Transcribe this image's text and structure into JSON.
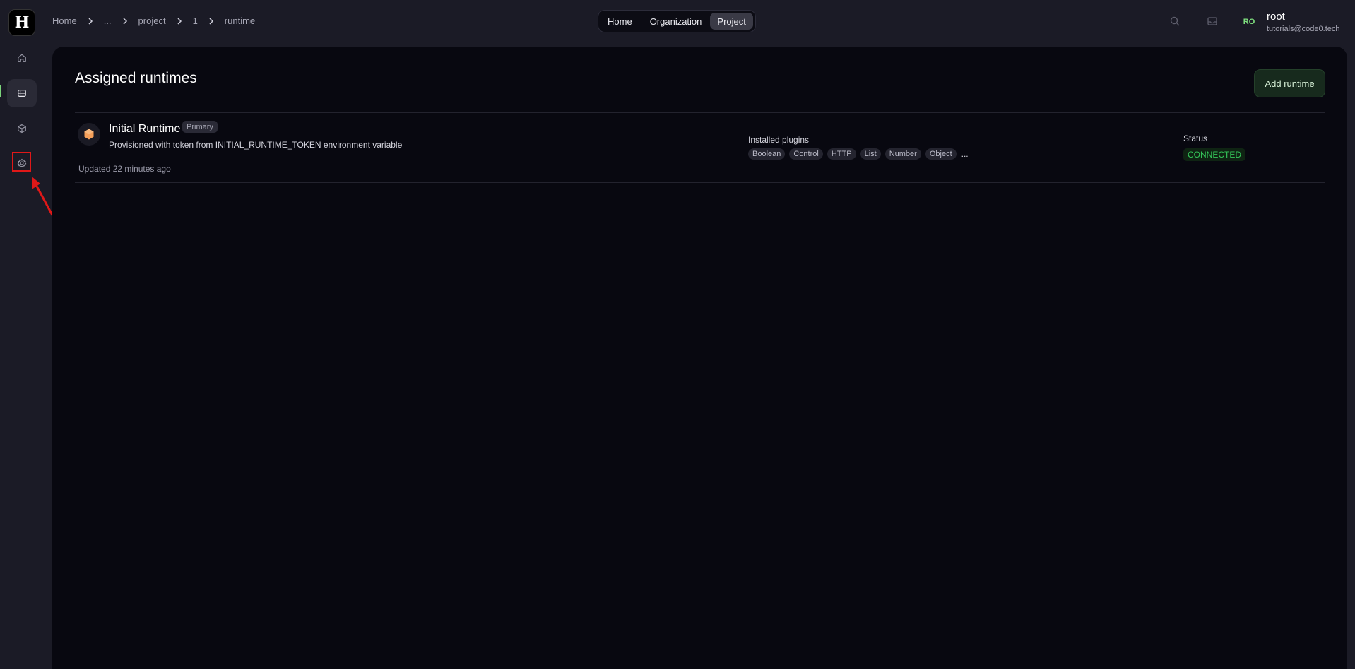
{
  "app": {
    "logo_glyph": "H"
  },
  "sidebar": {
    "items": [
      {
        "name": "home",
        "icon": "home-icon"
      },
      {
        "name": "runtimes",
        "icon": "server-icon",
        "active": true
      },
      {
        "name": "packages",
        "icon": "cube-icon"
      },
      {
        "name": "settings",
        "icon": "gear-icon",
        "highlighted": true
      }
    ]
  },
  "breadcrumb": [
    "Home",
    "...",
    "project",
    "1",
    "runtime"
  ],
  "scope_switch": {
    "options": [
      "Home",
      "Organization",
      "Project"
    ],
    "selected": "Project"
  },
  "user": {
    "initials": "RO",
    "name": "root",
    "email": "tutorials@code0.tech"
  },
  "main": {
    "title": "Assigned runtimes",
    "add_button_label": "Add runtime",
    "runtimes": [
      {
        "name": "Initial Runtime",
        "badge": "Primary",
        "description": "Provisioned with token from INITIAL_RUNTIME_TOKEN environment variable",
        "updated": "Updated 22 minutes ago",
        "plugins_label": "Installed plugins",
        "plugins": [
          "Boolean",
          "Control",
          "HTTP",
          "List",
          "Number",
          "Object"
        ],
        "plugins_more": "...",
        "status_label": "Status",
        "status": "CONNECTED"
      }
    ]
  },
  "colors": {
    "accent_green": "#34c759",
    "annotation_red": "#e01818",
    "runtime_icon": "#f5a05a"
  }
}
